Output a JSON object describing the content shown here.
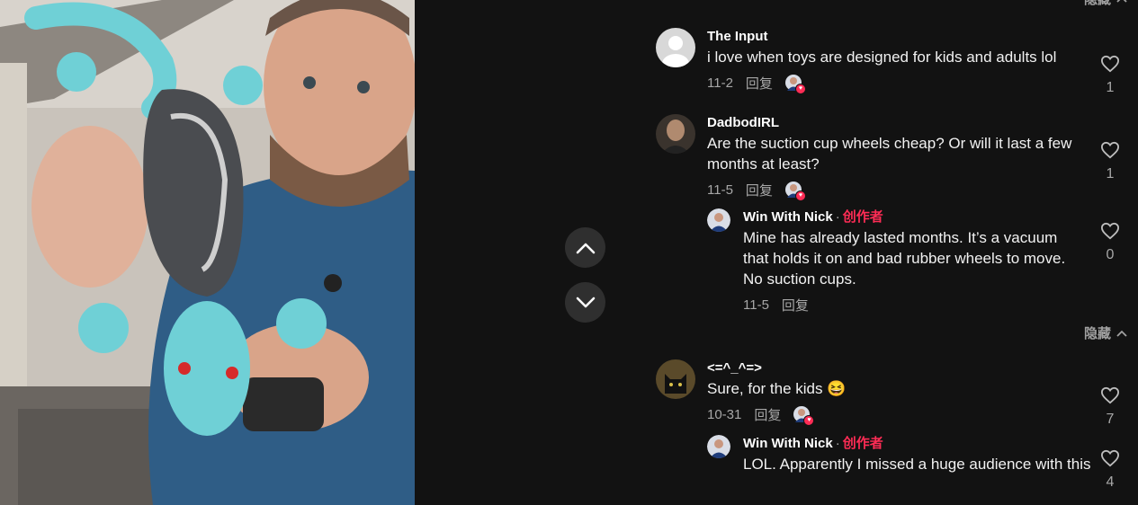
{
  "nav": {
    "up_icon": "chevron-up-icon",
    "down_icon": "chevron-down-icon"
  },
  "collapse_label_top": "隐藏",
  "collapse_label": "隐藏",
  "colors": {
    "accent": "#fe2c55",
    "panel_bg": "#121212"
  },
  "comments": [
    {
      "username": "The Input",
      "text": "i love when toys are designed for kids and adults lol",
      "date": "11-2",
      "reply_label": "回复",
      "likes": "1"
    },
    {
      "username": "DadbodIRL",
      "text": "Are the suction cup wheels cheap? Or will it last a few months at least?",
      "date": "11-5",
      "reply_label": "回复",
      "likes": "1",
      "reply": {
        "username": "Win With Nick",
        "separator": "·",
        "creator_tag": "创作者",
        "text": "Mine has already lasted months. It’s a vacuum that holds it on and bad rubber wheels to move. No suction cups.",
        "date": "11-5",
        "reply_label": "回复",
        "likes": "0"
      }
    },
    {
      "username": "<=^_^=>",
      "text": "Sure, for the kids 😆",
      "date": "10-31",
      "reply_label": "回复",
      "likes": "7",
      "reply": {
        "username": "Win With Nick",
        "separator": "·",
        "creator_tag": "创作者",
        "text": "LOL. Apparently I missed a huge audience with this",
        "likes": "4"
      }
    }
  ]
}
